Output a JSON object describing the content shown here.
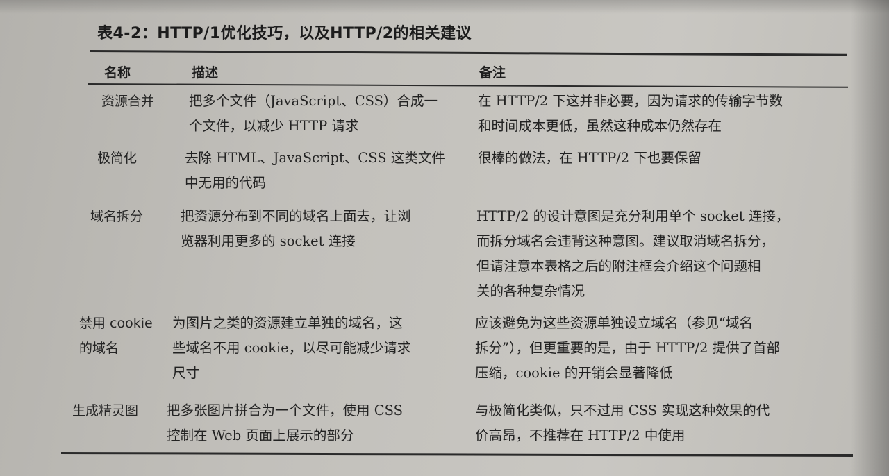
{
  "caption": "表4-2：HTTP/1优化技巧，以及HTTP/2的相关建议",
  "headers": {
    "name": "名称",
    "description": "描述",
    "notes": "备注"
  },
  "rows": [
    {
      "name": [
        "资源合并"
      ],
      "description": [
        "把多个文件（JavaScript、CSS）合成一",
        "个文件，以减少 HTTP 请求"
      ],
      "notes": [
        "在 HTTP/2 下这并非必要，因为请求的传输字节数",
        "和时间成本更低，虽然这种成本仍然存在"
      ]
    },
    {
      "name": [
        "极简化"
      ],
      "description": [
        "去除 HTML、JavaScript、CSS 这类文件",
        "中无用的代码"
      ],
      "notes": [
        "很棒的做法，在 HTTP/2 下也要保留"
      ]
    },
    {
      "name": [
        "域名拆分"
      ],
      "description": [
        "把资源分布到不同的域名上面去，让浏",
        "览器利用更多的 socket 连接"
      ],
      "notes": [
        "HTTP/2 的设计意图是充分利用单个 socket 连接，",
        "而拆分域名会违背这种意图。建议取消域名拆分，",
        "但请注意本表格之后的附注框会介绍这个问题相",
        "关的各种复杂情况"
      ]
    },
    {
      "name": [
        "禁用 cookie",
        "的域名"
      ],
      "description": [
        "为图片之类的资源建立单独的域名，这",
        "些域名不用 cookie，以尽可能减少请求",
        "尺寸"
      ],
      "notes": [
        "应该避免为这些资源单独设立域名（参见“域名",
        "拆分”），但更重要的是，由于 HTTP/2 提供了首部",
        "压缩，cookie 的开销会显著降低"
      ]
    },
    {
      "name": [
        "生成精灵图"
      ],
      "description": [
        "把多张图片拼合为一个文件，使用 CSS",
        "控制在 Web 页面上展示的部分"
      ],
      "notes": [
        "与极简化类似，只不过用 CSS 实现这种效果的代",
        "价高昂，不推荐在 HTTP/2 中使用"
      ]
    }
  ]
}
